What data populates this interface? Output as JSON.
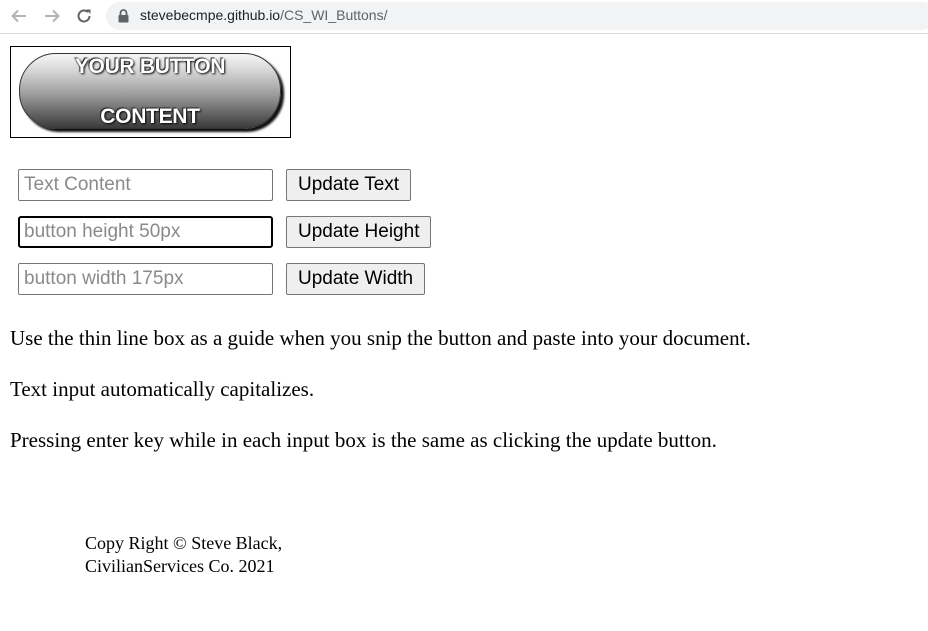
{
  "browser": {
    "url_host": "stevebecmpe.github.io",
    "url_path": "/CS_WI_Buttons/"
  },
  "preview": {
    "button_line1": "YOUR BUTTON",
    "button_line2": "CONTENT"
  },
  "controls": {
    "text": {
      "placeholder": "Text Content",
      "button_label": "Update Text"
    },
    "height": {
      "placeholder": "button height 50px",
      "button_label": "Update Height"
    },
    "width": {
      "placeholder": "button width 175px",
      "button_label": "Update Width"
    }
  },
  "instructions": [
    "Use the thin line box as a guide when you snip the button and paste into your document.",
    "Text input automatically capitalizes.",
    "Pressing enter key while in each input box is the same as clicking the update button."
  ],
  "footer": {
    "line1": "Copy Right © Steve Black,",
    "line2": "CivilianServices Co. 2021"
  },
  "icons": {
    "back": "back-arrow-icon",
    "forward": "forward-arrow-icon",
    "reload": "reload-icon",
    "lock": "lock-icon"
  }
}
